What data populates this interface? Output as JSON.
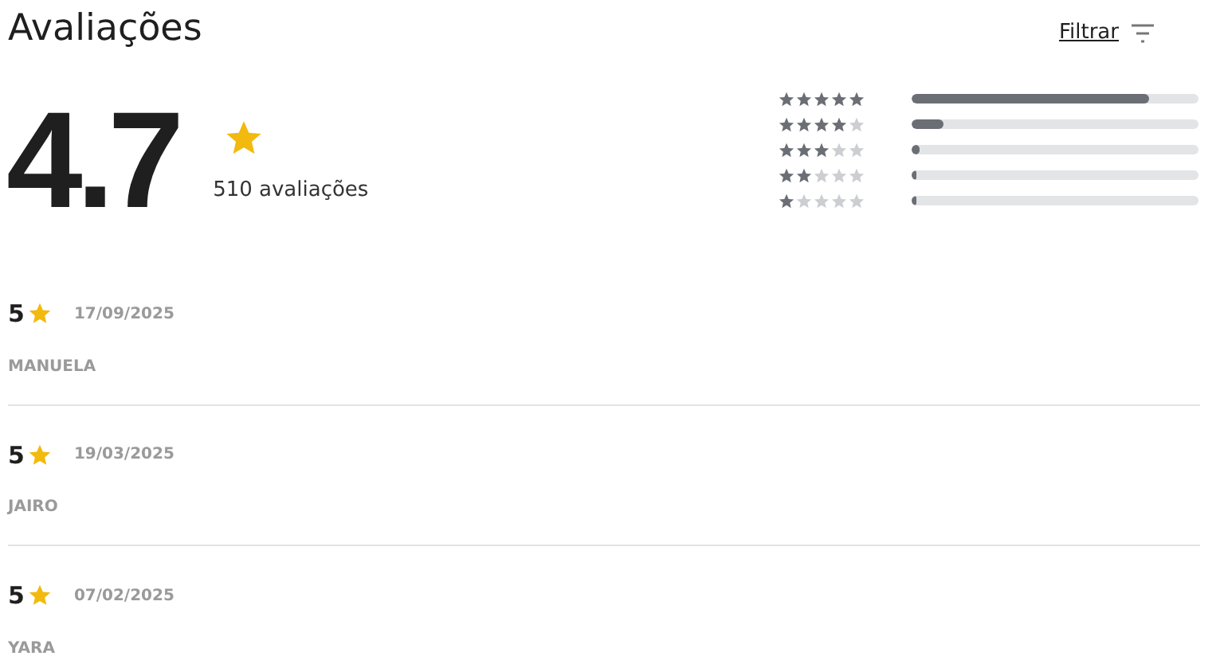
{
  "title": "Avaliações",
  "filter": {
    "label": "Filtrar"
  },
  "summary": {
    "score": "4.7",
    "count": "510 avaliações"
  },
  "distribution": [
    {
      "stars": 5,
      "level": 0.83
    },
    {
      "stars": 4,
      "level": 0.11
    },
    {
      "stars": 3,
      "level": 0.03
    },
    {
      "stars": 2,
      "level": 0.015
    },
    {
      "stars": 1,
      "level": 0.015
    }
  ],
  "reviews": [
    {
      "rating": "5",
      "date": "17/09/2025",
      "author": "MANUELA"
    },
    {
      "rating": "5",
      "date": "19/03/2025",
      "author": "JAIRO"
    },
    {
      "rating": "5",
      "date": "07/02/2025",
      "author": "YARA"
    }
  ]
}
